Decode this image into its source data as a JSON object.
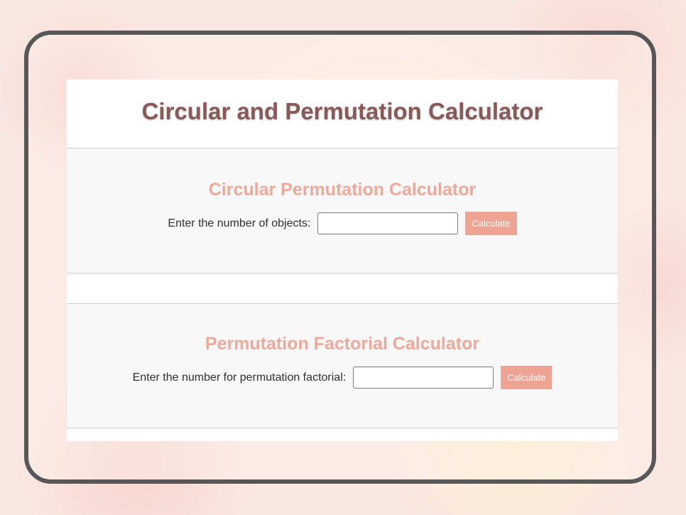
{
  "page": {
    "title": "Circular and Permutation Calculator"
  },
  "circular": {
    "heading": "Circular Permutation Calculator",
    "label": "Enter the number of objects:",
    "input_value": "",
    "button_label": "Calculate"
  },
  "factorial": {
    "heading": "Permutation Factorial Calculator",
    "label": "Enter the number for permutation factorial:",
    "input_value": "",
    "button_label": "Calculate"
  },
  "colors": {
    "title": "#8a5856",
    "accent": "#efa393",
    "frame": "#575757"
  }
}
